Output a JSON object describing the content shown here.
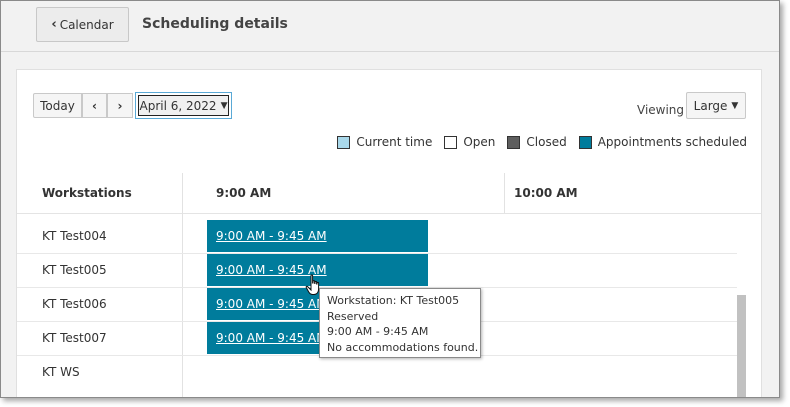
{
  "header": {
    "back_label": "Calendar",
    "title": "Scheduling details"
  },
  "toolbar": {
    "today_label": "Today",
    "prev_icon": "chevron-left-icon",
    "next_icon": "chevron-right-icon",
    "date_value": "April 6, 2022",
    "viewing_label": "Viewing",
    "size_value": "Large"
  },
  "legend": [
    {
      "label": "Current time",
      "color": "#a9d8ea"
    },
    {
      "label": "Open",
      "color": "#ffffff"
    },
    {
      "label": "Closed",
      "color": "#5e5e5e"
    },
    {
      "label": "Appointments scheduled",
      "color": "#007c9c"
    }
  ],
  "grid": {
    "workstations_header": "Workstations",
    "time_headers": [
      "9:00 AM",
      "10:00 AM"
    ],
    "rows": [
      {
        "label": "KT Test004",
        "appointment": "9:00 AM - 9:45 AM"
      },
      {
        "label": "KT Test005",
        "appointment": "9:00 AM - 9:45 AM"
      },
      {
        "label": "KT Test006",
        "appointment": "9:00 AM - 9:45 AM"
      },
      {
        "label": "KT Test007",
        "appointment": "9:00 AM - 9:45 AM"
      },
      {
        "label": "KT WS",
        "appointment": ""
      }
    ]
  },
  "tooltip": {
    "lines": [
      "Workstation: KT Test005",
      "Reserved",
      "9:00 AM - 9:45 AM",
      "No accommodations found."
    ]
  },
  "colors": {
    "appointment": "#007c9c",
    "focus_ring": "#5aa9d6"
  }
}
